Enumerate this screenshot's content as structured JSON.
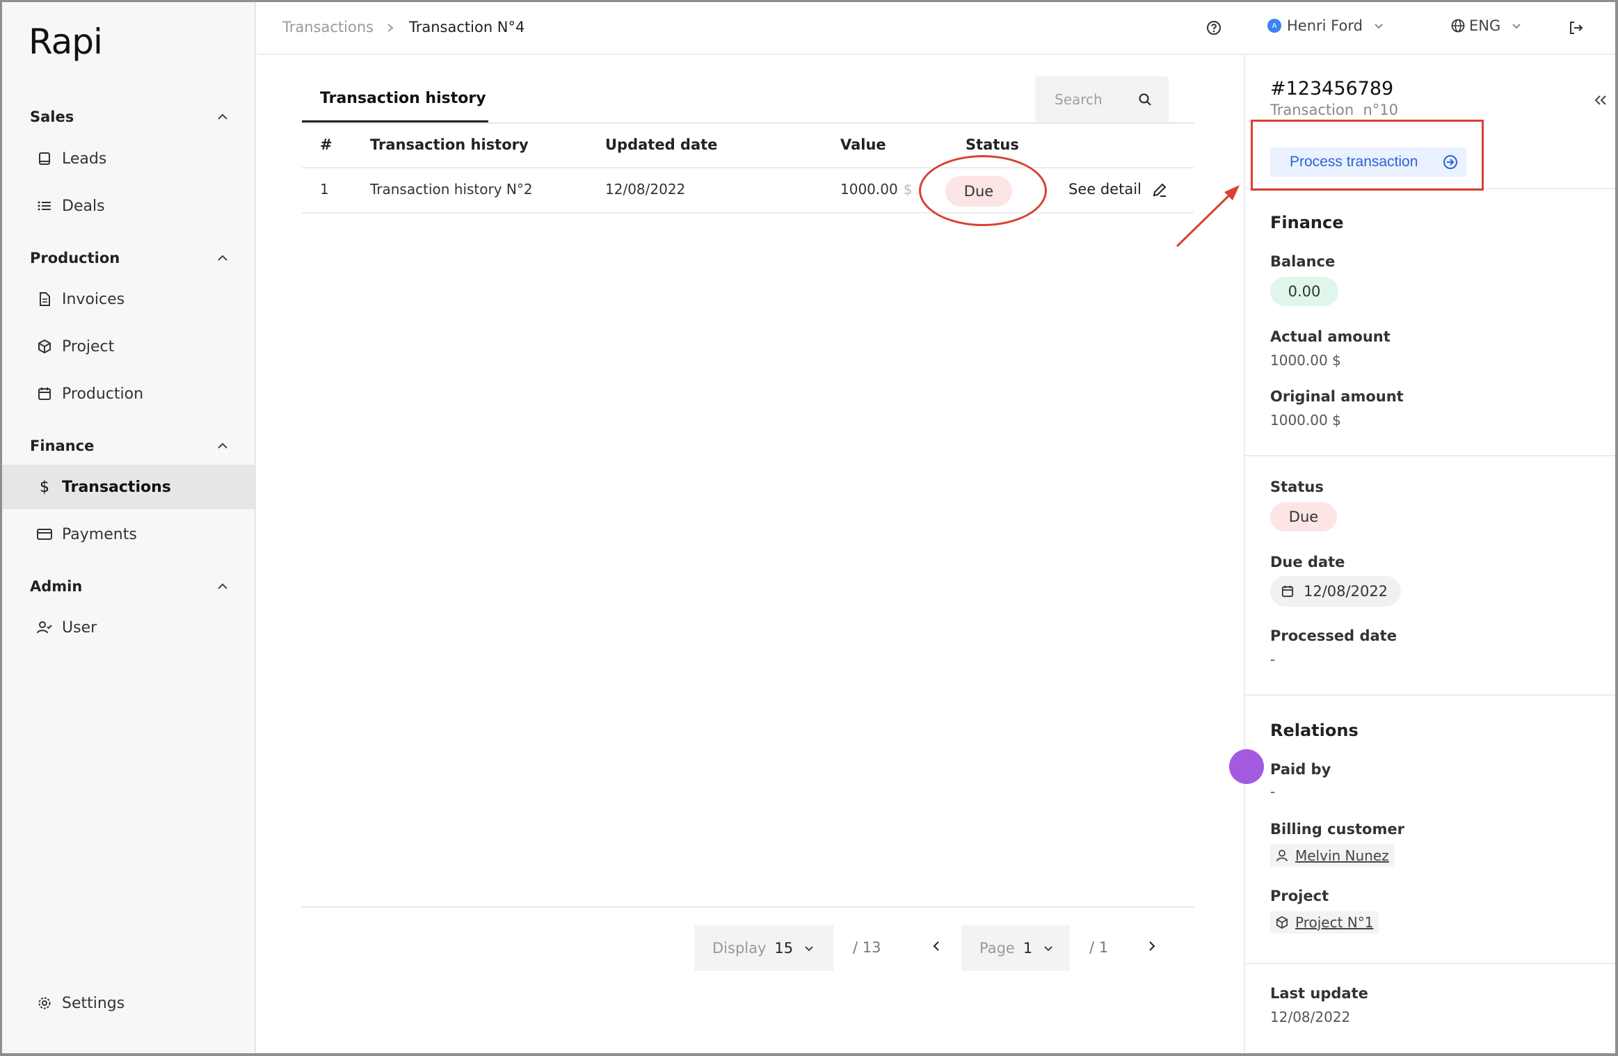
{
  "app": {
    "logo_text": "Rapi"
  },
  "sidebar": {
    "sections": [
      {
        "title": "Sales",
        "items": [
          "Leads",
          "Deals"
        ]
      },
      {
        "title": "Production",
        "items": [
          "Invoices",
          "Project",
          "Production"
        ]
      },
      {
        "title": "Finance",
        "items": [
          "Transactions",
          "Payments"
        ]
      },
      {
        "title": "Admin",
        "items": [
          "User"
        ]
      }
    ],
    "sales_title": "Sales",
    "leads": "Leads",
    "deals": "Deals",
    "production_title": "Production",
    "invoices": "Invoices",
    "project": "Project",
    "production": "Production",
    "finance_title": "Finance",
    "transactions": "Transactions",
    "payments": "Payments",
    "admin_title": "Admin",
    "user": "User",
    "settings": "Settings",
    "active_item": "Transactions"
  },
  "topbar": {
    "breadcrumb_root": "Transactions",
    "breadcrumb_current": "Transaction N°4",
    "user_name": "Henri Ford",
    "user_initial": "A",
    "language": "ENG"
  },
  "main": {
    "tab_label": "Transaction history",
    "search_placeholder": "Search",
    "columns": [
      "#",
      "Transaction history",
      "Updated date",
      "Value",
      "Status"
    ],
    "col_num": "#",
    "col_history": "Transaction history",
    "col_date": "Updated date",
    "col_value": "Value",
    "col_status": "Status",
    "rows": [
      {
        "num": "1",
        "history": "Transaction history N°2",
        "date": "12/08/2022",
        "value": "1000.00",
        "unit": "$",
        "status": "Due",
        "action": "See detail"
      }
    ]
  },
  "pagination": {
    "display_label": "Display",
    "display_value": "15",
    "total_items": "/ 13",
    "page_label": "Page",
    "page_value": "1",
    "total_pages": "/ 1"
  },
  "panel": {
    "id": "#123456789",
    "subtitle": "Transaction  n°10",
    "process_button": "Process transaction",
    "finance_heading": "Finance",
    "balance_label": "Balance",
    "balance_value": "0.00",
    "actual_label": "Actual amount",
    "actual_value": "1000.00 $",
    "original_label": "Original amount",
    "original_value": "1000.00 $",
    "status_label": "Status",
    "status_value": "Due",
    "due_label": "Due date",
    "due_value": "12/08/2022",
    "processed_label": "Processed date",
    "processed_value": "-",
    "relations_heading": "Relations",
    "paid_by_label": "Paid by",
    "paid_by_value": "-",
    "billing_label": "Billing customer",
    "billing_value": "Melvin Nunez",
    "project_label": "Project",
    "project_value": "Project N°1",
    "last_update_label": "Last update",
    "last_update_value": "12/08/2022"
  },
  "colors": {
    "accent_blue": "#2a63d6",
    "due_badge": "#fde5e5",
    "balance_badge": "#dff7ea",
    "annotation_red": "#d94130",
    "cursor_dot": "#a25bdf"
  }
}
